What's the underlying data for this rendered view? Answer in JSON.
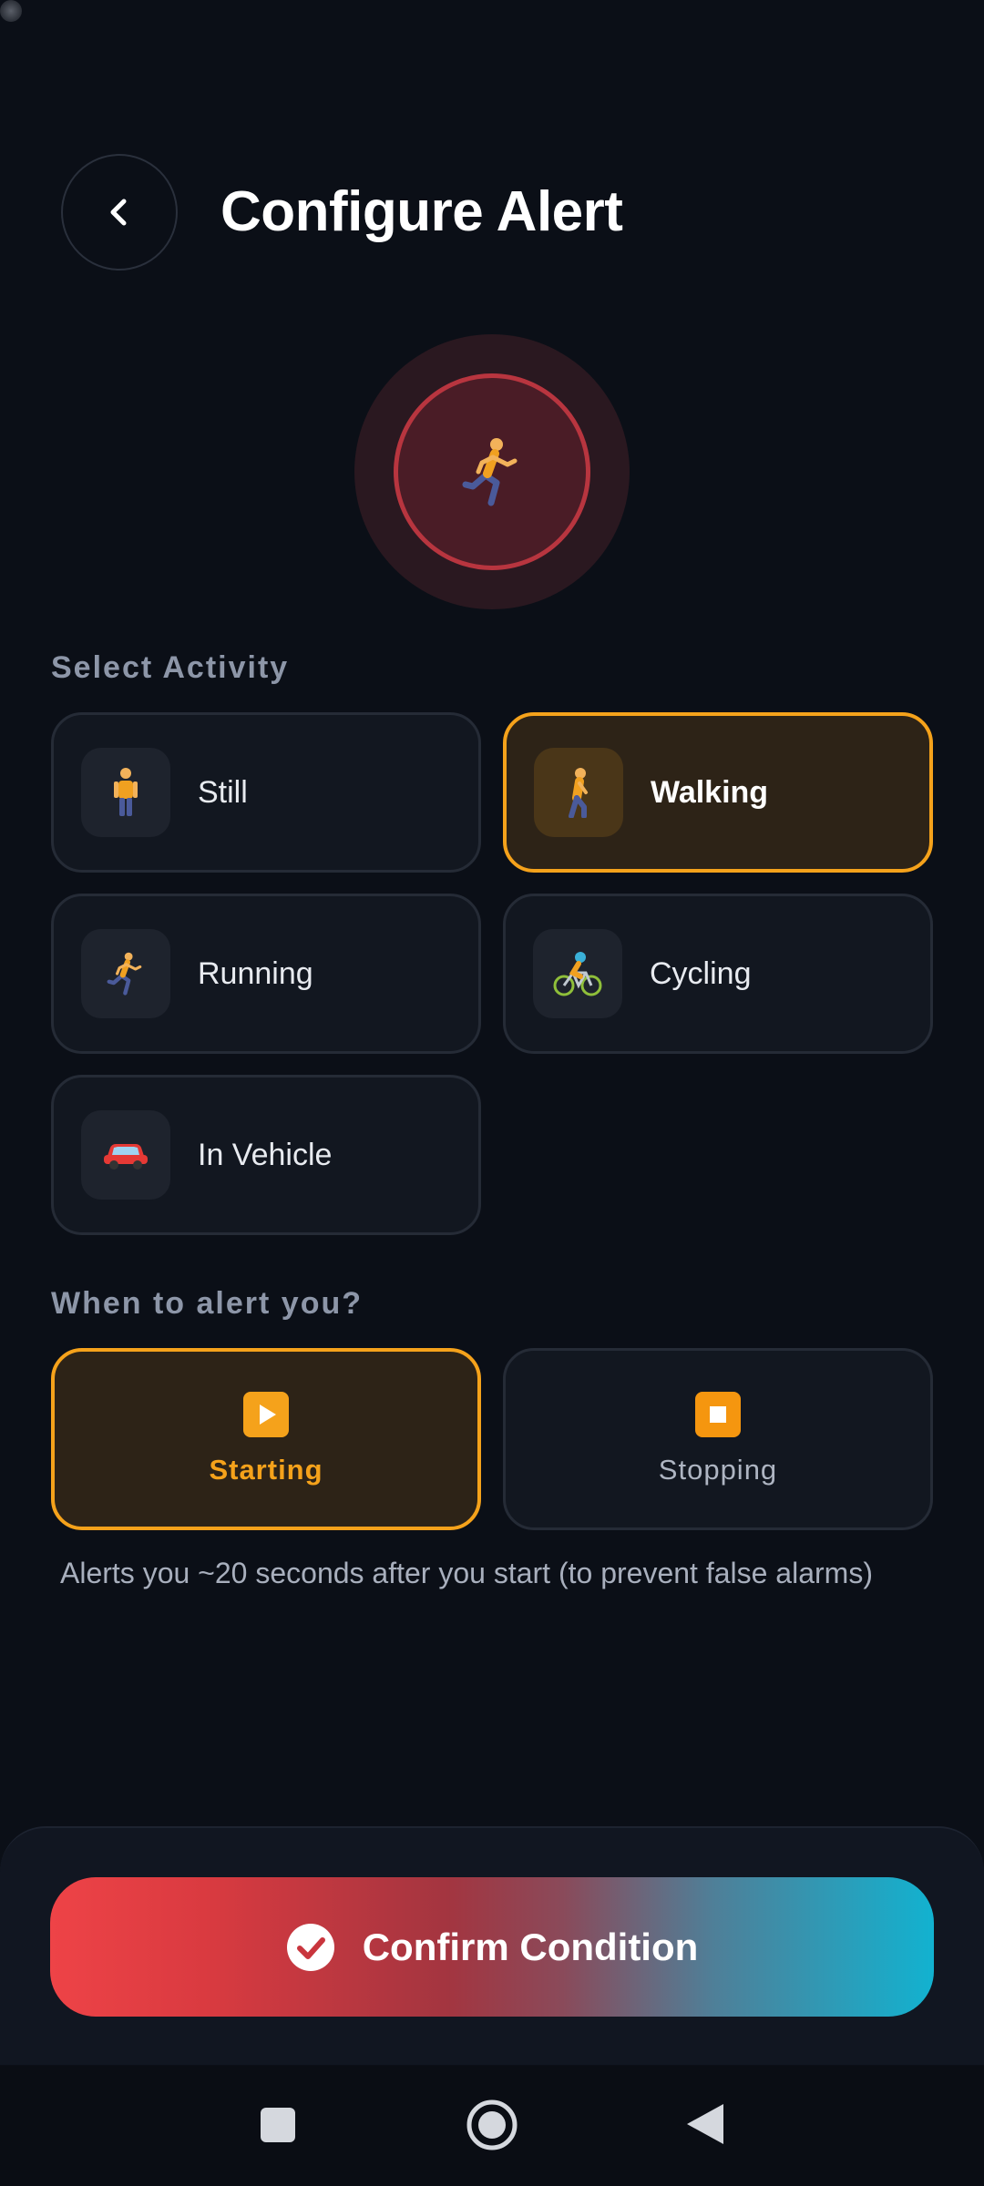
{
  "header": {
    "title": "Configure Alert"
  },
  "select_activity": {
    "label": "Select Activity",
    "selected": "Walking",
    "items": [
      {
        "label": "Still",
        "icon": "standing-person-icon"
      },
      {
        "label": "Walking",
        "icon": "walking-person-icon"
      },
      {
        "label": "Running",
        "icon": "running-person-icon"
      },
      {
        "label": "Cycling",
        "icon": "cyclist-icon"
      },
      {
        "label": "In Vehicle",
        "icon": "car-icon"
      }
    ]
  },
  "when_to_alert": {
    "label": "When to alert you?",
    "selected": "Starting",
    "options": [
      {
        "label": "Starting",
        "icon": "play-icon"
      },
      {
        "label": "Stopping",
        "icon": "stop-icon"
      }
    ],
    "helper": "Alerts you ~20 seconds after you start (to prevent false alarms)"
  },
  "confirm": {
    "label": "Confirm Condition"
  },
  "colors": {
    "accent": "#f5a21b",
    "background": "#0b0f17",
    "card": "#121720",
    "gradient_start": "#ee4347",
    "gradient_end": "#12b2d0"
  }
}
